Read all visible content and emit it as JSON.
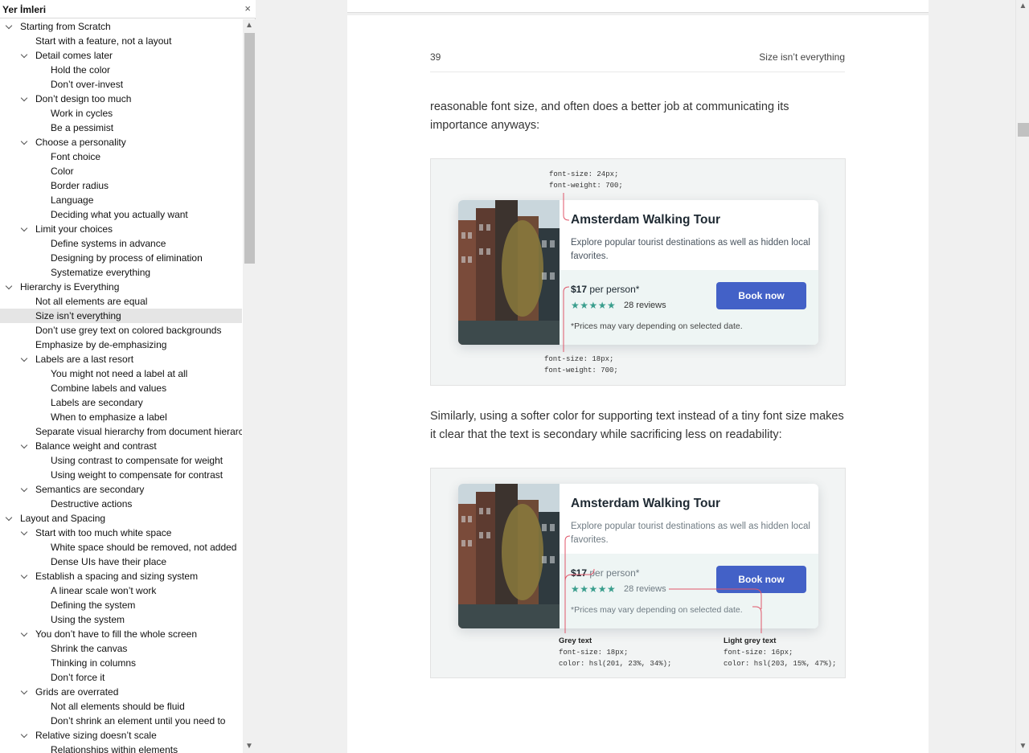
{
  "sidebar": {
    "title": "Yer İmleri",
    "close_label": "×",
    "items": [
      {
        "label": "Starting from Scratch",
        "level": 0,
        "expanded": true
      },
      {
        "label": "Start with a feature, not a layout",
        "level": 1
      },
      {
        "label": "Detail comes later",
        "level": 1,
        "expanded": true
      },
      {
        "label": "Hold the color",
        "level": 2
      },
      {
        "label": "Don’t over-invest",
        "level": 2
      },
      {
        "label": "Don’t design too much",
        "level": 1,
        "expanded": true
      },
      {
        "label": "Work in cycles",
        "level": 2
      },
      {
        "label": "Be a pessimist",
        "level": 2
      },
      {
        "label": "Choose a personality",
        "level": 1,
        "expanded": true
      },
      {
        "label": "Font choice",
        "level": 2
      },
      {
        "label": "Color",
        "level": 2
      },
      {
        "label": "Border radius",
        "level": 2
      },
      {
        "label": "Language",
        "level": 2
      },
      {
        "label": "Deciding what you actually want",
        "level": 2
      },
      {
        "label": "Limit your choices",
        "level": 1,
        "expanded": true
      },
      {
        "label": "Define systems in advance",
        "level": 2
      },
      {
        "label": "Designing by process of elimination",
        "level": 2
      },
      {
        "label": "Systematize everything",
        "level": 2
      },
      {
        "label": "Hierarchy is Everything",
        "level": 0,
        "expanded": true
      },
      {
        "label": "Not all elements are equal",
        "level": 1
      },
      {
        "label": "Size isn’t everything",
        "level": 1,
        "selected": true
      },
      {
        "label": "Don’t use grey text on colored backgrounds",
        "level": 1
      },
      {
        "label": "Emphasize by de-emphasizing",
        "level": 1
      },
      {
        "label": "Labels are a last resort",
        "level": 1,
        "expanded": true
      },
      {
        "label": "You might not need a label at all",
        "level": 2
      },
      {
        "label": "Combine labels and values",
        "level": 2
      },
      {
        "label": "Labels are secondary",
        "level": 2
      },
      {
        "label": "When to emphasize a label",
        "level": 2
      },
      {
        "label": "Separate visual hierarchy from document hierarc",
        "level": 1
      },
      {
        "label": "Balance weight and contrast",
        "level": 1,
        "expanded": true
      },
      {
        "label": "Using contrast to compensate for weight",
        "level": 2
      },
      {
        "label": "Using weight to compensate for contrast",
        "level": 2
      },
      {
        "label": "Semantics are secondary",
        "level": 1,
        "expanded": true
      },
      {
        "label": "Destructive actions",
        "level": 2
      },
      {
        "label": "Layout and Spacing",
        "level": 0,
        "expanded": true
      },
      {
        "label": "Start with too much white space",
        "level": 1,
        "expanded": true
      },
      {
        "label": "White space should be removed, not added",
        "level": 2
      },
      {
        "label": "Dense UIs have their place",
        "level": 2
      },
      {
        "label": "Establish a spacing and sizing system",
        "level": 1,
        "expanded": true
      },
      {
        "label": "A linear scale won’t work",
        "level": 2
      },
      {
        "label": "Defining the system",
        "level": 2
      },
      {
        "label": "Using the system",
        "level": 2
      },
      {
        "label": "You don’t have to fill the whole screen",
        "level": 1,
        "expanded": true
      },
      {
        "label": "Shrink the canvas",
        "level": 2
      },
      {
        "label": "Thinking in columns",
        "level": 2
      },
      {
        "label": "Don’t force it",
        "level": 2
      },
      {
        "label": "Grids are overrated",
        "level": 1,
        "expanded": true
      },
      {
        "label": "Not all elements should be fluid",
        "level": 2
      },
      {
        "label": "Don’t shrink an element until you need to",
        "level": 2
      },
      {
        "label": "Relative sizing doesn’t scale",
        "level": 1,
        "expanded": true
      },
      {
        "label": "Relationships within elements",
        "level": 2
      }
    ]
  },
  "page": {
    "number": "39",
    "running_title": "Size isn’t everything",
    "para1": "reasonable font size, and often does a better job at communicating its importance anyways:",
    "para2": "Similarly, using a softer color for supporting text instead of a tiny font size makes it clear that the text is secondary while sacrificing less on readability:"
  },
  "card": {
    "title": "Amsterdam Walking Tour",
    "description": "Explore popular tourist destinations as well as hidden local favorites.",
    "price": "$17",
    "price_suffix": "per person*",
    "stars": "★★★★★",
    "reviews": "28 reviews",
    "note": "*Prices may vary depending on selected date.",
    "button": "Book now"
  },
  "figure1": {
    "top_code": "font-size: 24px;\nfont-weight: 700;",
    "bottom_code": "font-size: 18px;\nfont-weight: 700;"
  },
  "figure2": {
    "grey_head": "Grey text",
    "grey_code": "font-size: 18px;\ncolor: hsl(201, 23%, 34%);",
    "light_head": "Light grey text",
    "light_code": "font-size: 16px;\ncolor: hsl(203, 15%, 47%);"
  },
  "colors": {
    "button": "#4361c7",
    "stars": "#3a9e8d",
    "annotation": "#e0566a",
    "selected_row": "#e5e5e5"
  }
}
